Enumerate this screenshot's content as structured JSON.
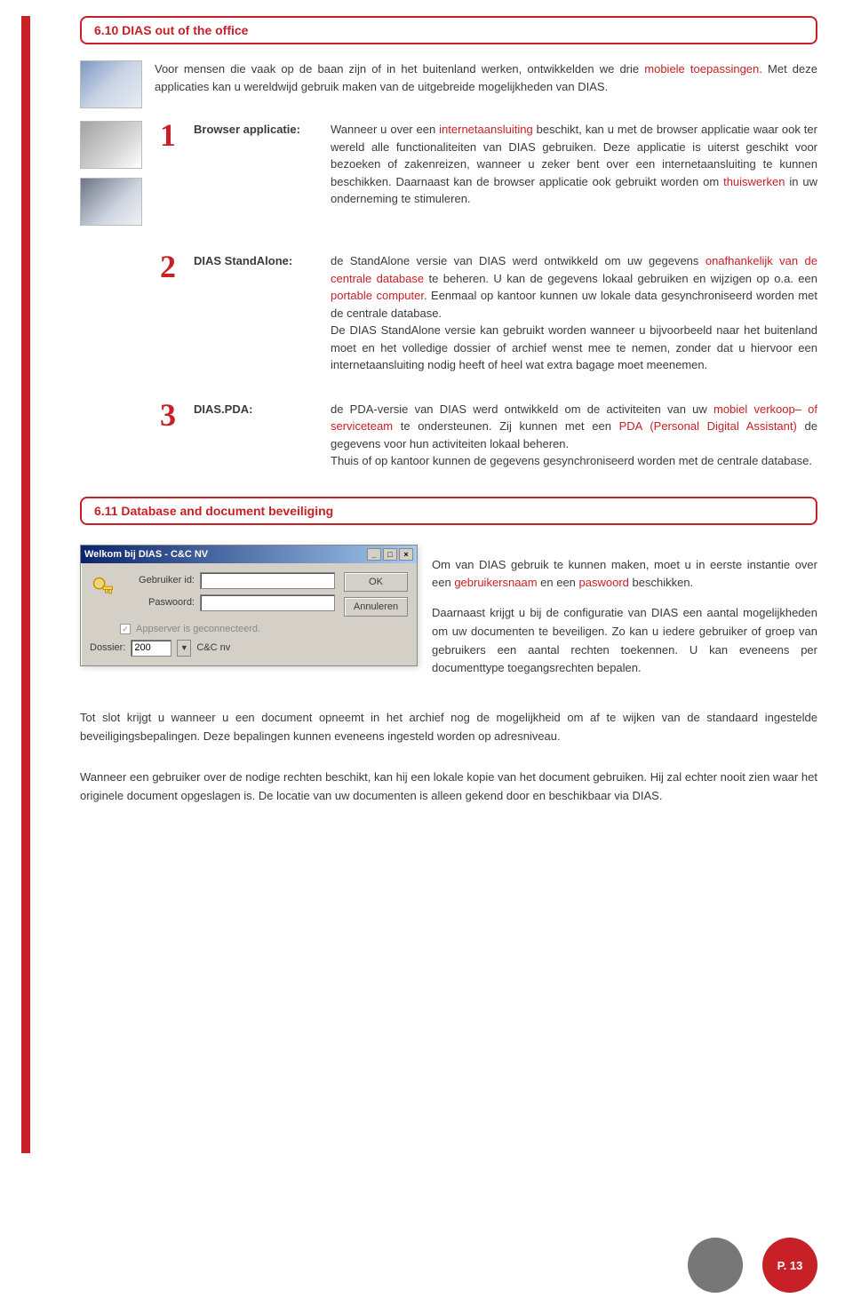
{
  "section610": {
    "title": "6.10 DIAS out of the office",
    "intro_before": "Voor mensen die vaak op de baan zijn of in het buitenland werken, ontwikkelden we drie ",
    "intro_red": "mobiele toepassingen",
    "intro_after": ". Met deze applicaties kan u wereldwijd gebruik maken van de uitgebreide mogelijkheden van DIAS.",
    "items": [
      {
        "num": "1",
        "label": "Browser applicatie:",
        "p1a": "Wanneer u over een ",
        "p1r1": "internetaansluiting",
        "p1b": " beschikt, kan u met de browser applicatie waar ook ter wereld alle functionaliteiten van DIAS gebruiken. Deze applicatie is uiterst geschikt voor bezoeken of zakenreizen, wanneer u zeker bent over een internetaansluiting te kunnen beschikken. Daarnaast kan de browser applicatie ook gebruikt worden om ",
        "p1r2": "thuiswerken",
        "p1c": " in uw onderneming te stimuleren."
      },
      {
        "num": "2",
        "label": "DIAS StandAlone:",
        "p1a": "de StandAlone versie van DIAS werd ontwikkeld om uw gegevens ",
        "p1r1": "onafhankelijk van de centrale database",
        "p1b": " te beheren. U kan de gegevens lokaal gebruiken en wijzigen op o.a. een ",
        "p1r2": "portable computer",
        "p1c": ". Eenmaal op kantoor kunnen uw lokale data gesynchroniseerd worden met de centrale database.",
        "p2": "De DIAS StandAlone versie kan gebruikt worden wanneer u bijvoorbeeld naar het buitenland moet en het volledige dossier of archief wenst mee te nemen, zonder dat u hiervoor een internetaansluiting nodig heeft of heel wat extra bagage moet meenemen."
      },
      {
        "num": "3",
        "label": "DIAS.PDA:",
        "p1a": "de PDA-versie van DIAS werd ontwikkeld om de activiteiten van uw ",
        "p1r1": "mobiel verkoop– of serviceteam",
        "p1b": " te ondersteunen. Zij kunnen met een ",
        "p1r2": "PDA (Personal Digital Assistant)",
        "p1c": " de gegevens voor hun activiteiten lokaal beheren.",
        "p2": "Thuis of op kantoor kunnen de gegevens gesynchroniseerd worden met de centrale database."
      }
    ]
  },
  "section611": {
    "title": "6.11 Database and document beveiliging",
    "login": {
      "windowTitle": "Welkom bij DIAS - C&C NV",
      "userLabel": "Gebruiker id:",
      "passLabel": "Paswoord:",
      "ok": "OK",
      "cancel": "Annuleren",
      "status": "Appserver is geconnecteerd.",
      "dossierLabel": "Dossier:",
      "dossierValue": "200",
      "dossierName": "C&C nv"
    },
    "side1a": "Om van DIAS gebruik te kunnen maken, moet u in eerste instantie over een ",
    "side1r1": "gebruikersnaam",
    "side1mid": " en een ",
    "side1r2": "paswoord",
    "side1b": " beschikken.",
    "side2": "Daarnaast krijgt u bij de configuratie van DIAS een aantal mogelijkheden om uw documenten te beveiligen. Zo kan u iedere gebruiker of groep van gebruikers een aantal rechten toekennen. U kan eveneens per documenttype toegangsrechten bepalen.",
    "foot1": "Tot slot krijgt u wanneer u een document opneemt in het archief nog de mogelijkheid om af te wijken van de standaard ingestelde beveiligingsbepalingen. Deze bepalingen kunnen eveneens ingesteld worden op adresniveau.",
    "foot2": "Wanneer een gebruiker over de nodige rechten beschikt, kan hij een lokale kopie van het document gebruiken. Hij zal echter nooit zien waar het originele document opgeslagen is. De locatie van uw documenten is alleen gekend door en beschikbaar via DIAS."
  },
  "pageNum": "P. 13"
}
